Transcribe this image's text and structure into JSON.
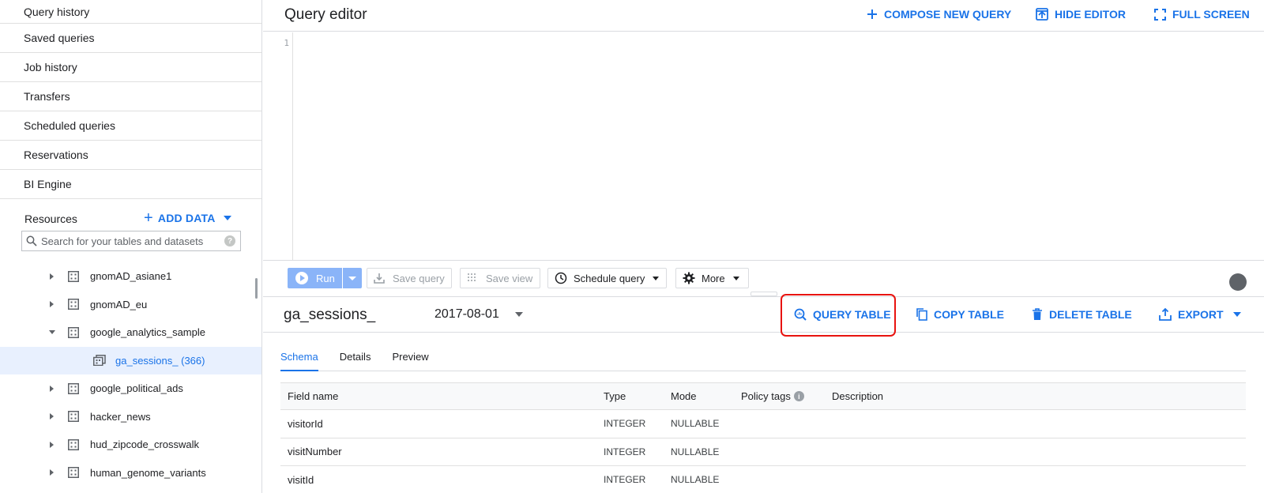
{
  "sidebar": {
    "nav_items": [
      "Query history",
      "Saved queries",
      "Job history",
      "Transfers",
      "Scheduled queries",
      "Reservations",
      "BI Engine"
    ],
    "resources_label": "Resources",
    "add_data_label": "ADD DATA",
    "search_placeholder": "Search for your tables and datasets",
    "search_help": "?",
    "tree": [
      {
        "label": "gnomAD_asiane1",
        "expanded": false
      },
      {
        "label": "gnomAD_eu",
        "expanded": false
      },
      {
        "label": "google_analytics_sample",
        "expanded": true
      },
      {
        "label": "ga_sessions_ (366)",
        "selected": true
      },
      {
        "label": "google_political_ads",
        "expanded": false
      },
      {
        "label": "hacker_news",
        "expanded": false
      },
      {
        "label": "hud_zipcode_crosswalk",
        "expanded": false
      },
      {
        "label": "human_genome_variants",
        "expanded": false
      }
    ]
  },
  "editor": {
    "title": "Query editor",
    "compose_label": "COMPOSE NEW QUERY",
    "hide_label": "HIDE EDITOR",
    "fullscreen_label": "FULL SCREEN",
    "line_number": "1"
  },
  "toolbar": {
    "run_label": "Run",
    "save_query_label": "Save query",
    "save_view_label": "Save view",
    "schedule_label": "Schedule query",
    "more_label": "More"
  },
  "table": {
    "name": "ga_sessions_",
    "partition": "2017-08-01",
    "query_label": "QUERY TABLE",
    "copy_label": "COPY TABLE",
    "delete_label": "DELETE TABLE",
    "export_label": "EXPORT"
  },
  "tabs": [
    "Schema",
    "Details",
    "Preview"
  ],
  "schema": {
    "headers": {
      "field": "Field name",
      "type": "Type",
      "mode": "Mode",
      "policy": "Policy tags",
      "description": "Description"
    },
    "rows": [
      {
        "field": "visitorId",
        "type": "INTEGER",
        "mode": "NULLABLE"
      },
      {
        "field": "visitNumber",
        "type": "INTEGER",
        "mode": "NULLABLE"
      },
      {
        "field": "visitId",
        "type": "INTEGER",
        "mode": "NULLABLE"
      }
    ]
  },
  "colors": {
    "accent": "#1a73e8",
    "highlight": "#e8130f",
    "selected_bg": "#e8f0fe"
  }
}
